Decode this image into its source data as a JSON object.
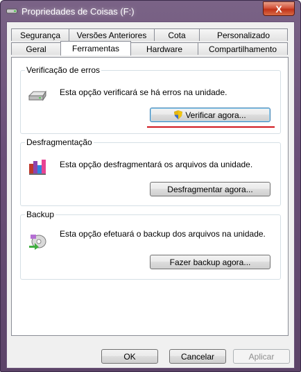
{
  "window": {
    "title": "Propriedades de Coisas (F:)",
    "close_label": "X"
  },
  "tabs_row1": [
    "Segurança",
    "Versões Anteriores",
    "Cota",
    "Personalizado"
  ],
  "tabs_row2": [
    "Geral",
    "Ferramentas",
    "Hardware",
    "Compartilhamento"
  ],
  "selected_tab": "Ferramentas",
  "groups": {
    "check": {
      "title": "Verificação de erros",
      "description": "Esta opção verificará se há erros na unidade.",
      "button": "Verificar agora..."
    },
    "defrag": {
      "title": "Desfragmentação",
      "description": "Esta opção desfragmentará os arquivos da unidade.",
      "button": "Desfragmentar agora..."
    },
    "backup": {
      "title": "Backup",
      "description": "Esta opção efetuará o backup dos arquivos na unidade.",
      "button": "Fazer backup agora..."
    }
  },
  "footer": {
    "ok": "OK",
    "cancel": "Cancelar",
    "apply": "Aplicar"
  },
  "colors": {
    "highlight_underline": "#d0161d",
    "accent": "#3c7fb1"
  },
  "icons": {
    "title": "drive-icon",
    "check": "hard-drive-icon",
    "defrag": "defragment-icon",
    "backup": "backup-icon",
    "shield": "uac-shield-icon"
  }
}
